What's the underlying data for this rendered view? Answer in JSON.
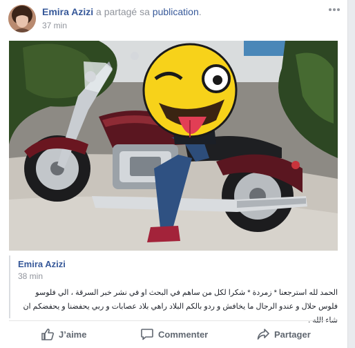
{
  "post": {
    "author": "Emira Azizi",
    "action_text": " a partagé sa ",
    "object_link": "publication",
    "period": ".",
    "time": "37 min"
  },
  "shared_post": {
    "author": "Emira Azizi",
    "time": "38 min",
    "text": "الحمد لله استرجعنا * زمردة * شكرا لكل من ساهم في البحث او في نشر خبر السرقة ، الي فلوسو فلوس حلال و عندو الرجال ما يخافش و ردو بالكم البلاد راهي بلاد عصابات و ربي يحفضنا و يحفضكم ان شاء الله ."
  },
  "actions": {
    "like": "J’aime",
    "comment": "Commenter",
    "share": "Partager"
  },
  "colors": {
    "link_blue": "#365899",
    "meta_gray": "#90949c",
    "action_gray": "#606770"
  },
  "icons": [
    "more-options-icon",
    "like-thumb-icon",
    "comment-bubble-icon",
    "share-arrow-icon",
    "emoji-tongue-icon"
  ]
}
